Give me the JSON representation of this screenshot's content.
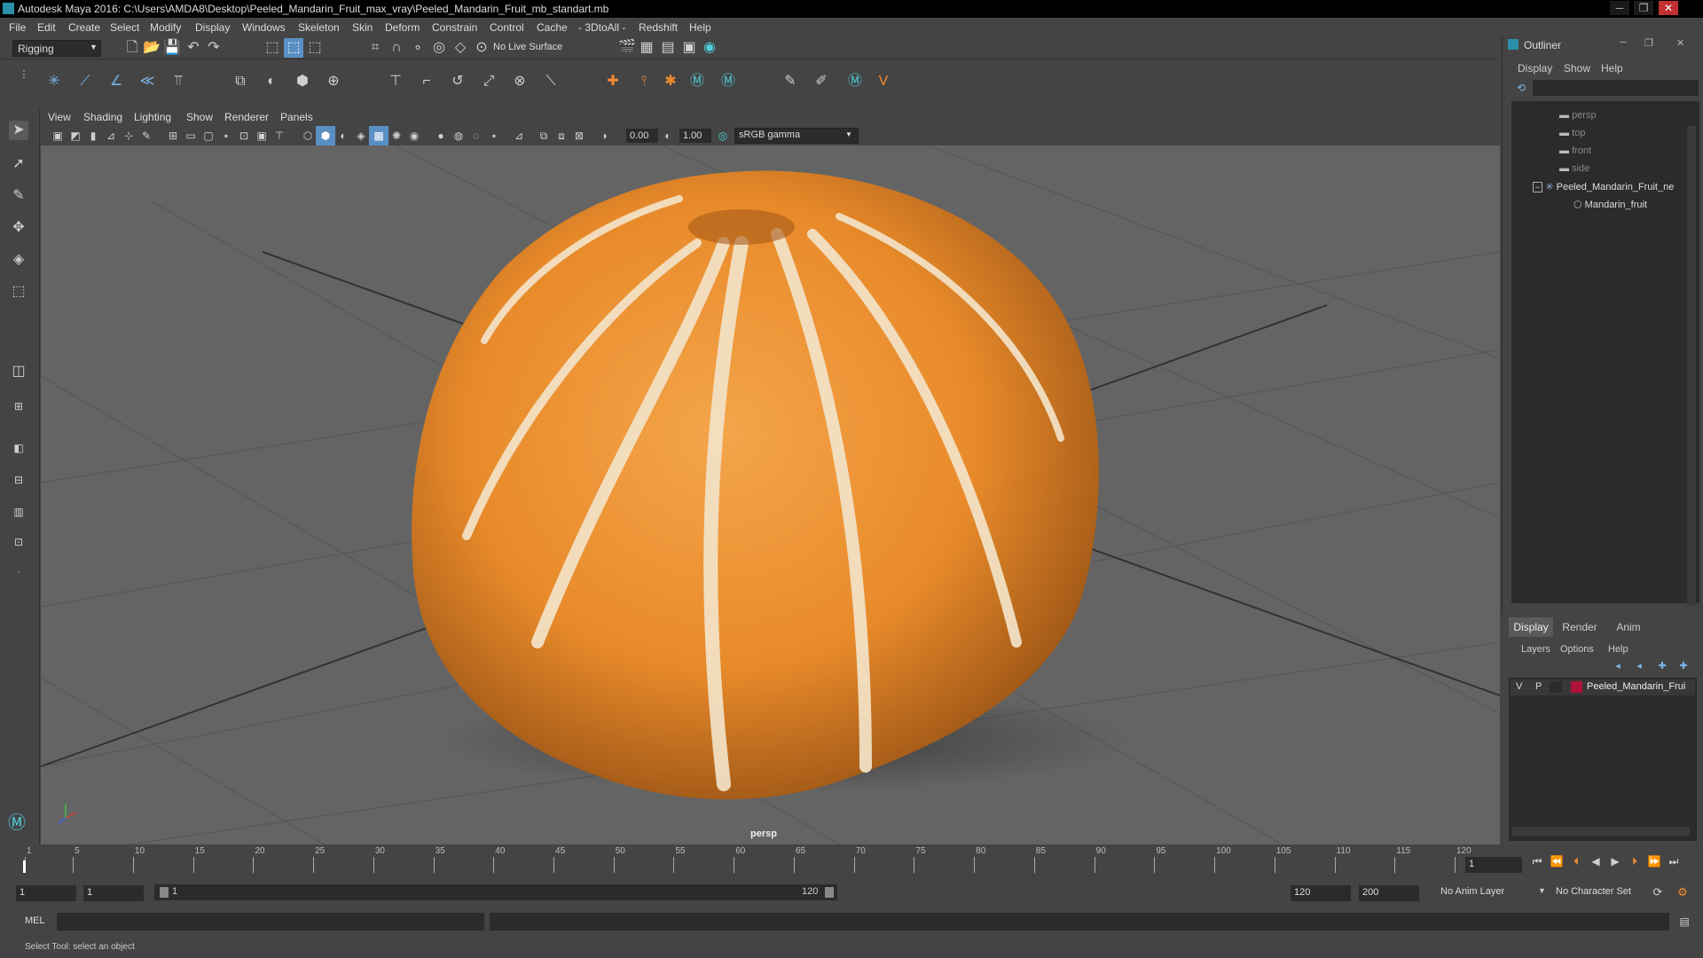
{
  "window": {
    "title": "Autodesk Maya 2016: C:\\Users\\AMDA8\\Desktop\\Peeled_Mandarin_Fruit_max_vray\\Peeled_Mandarin_Fruit_mb_standart.mb",
    "minimize": "─",
    "maximize": "❐",
    "close": "✕"
  },
  "menu": [
    "File",
    "Edit",
    "Create",
    "Select",
    "Modify",
    "Display",
    "Windows",
    "Skeleton",
    "Skin",
    "Deform",
    "Constrain",
    "Control",
    "Cache",
    "- 3DtoAll -",
    "Redshift",
    "Help"
  ],
  "shelf": {
    "mode": "Rigging",
    "live_surface": "No Live Surface"
  },
  "viewport": {
    "menu": [
      "View",
      "Shading",
      "Lighting",
      "Show",
      "Renderer",
      "Panels"
    ],
    "exposure": "0.00",
    "gamma": "1.00",
    "color_space": "sRGB gamma",
    "camera_label": "persp"
  },
  "outliner": {
    "title": "Outliner",
    "menu": [
      "Display",
      "Show",
      "Help"
    ],
    "items": [
      {
        "label": "persp"
      },
      {
        "label": "top"
      },
      {
        "label": "front"
      },
      {
        "label": "side"
      },
      {
        "label": "Peeled_Mandarin_Fruit_ne"
      },
      {
        "label": "Mandarin_fruit"
      }
    ]
  },
  "layers": {
    "tabs": [
      "Display",
      "Render",
      "Anim"
    ],
    "menu": [
      "Layers",
      "Options",
      "Help"
    ],
    "row": {
      "v": "V",
      "p": "P",
      "name": "Peeled_Mandarin_Frui",
      "color": "#b0123a"
    }
  },
  "timeline": {
    "ticks": [
      "1",
      "5",
      "10",
      "15",
      "20",
      "25",
      "30",
      "35",
      "40",
      "45",
      "50",
      "55",
      "60",
      "65",
      "70",
      "75",
      "80",
      "85",
      "90",
      "95",
      "100",
      "105",
      "110",
      "115",
      "120"
    ],
    "current_frame": "1"
  },
  "range": {
    "start": "1",
    "playback_start": "1",
    "slider_start": "1",
    "slider_end": "120",
    "playback_end": "120",
    "end": "200",
    "anim_layer": "No Anim Layer",
    "char_set": "No Character Set"
  },
  "mel": {
    "label": "MEL"
  },
  "status": {
    "text": "Select Tool: select an object"
  }
}
